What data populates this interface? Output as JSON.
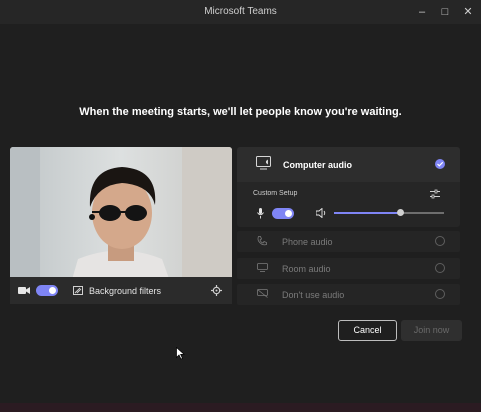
{
  "window": {
    "title": "Microsoft Teams",
    "controls": [
      "–",
      "□",
      "✕"
    ]
  },
  "headline": "When the meeting starts, we'll let people know you're waiting.",
  "video": {
    "camera_on": true,
    "background_filters_label": "Background filters"
  },
  "audio": {
    "selected": "Computer audio",
    "computer_audio_label": "Computer audio",
    "custom_setup_label": "Custom Setup",
    "mic_on": true,
    "volume_fraction": 0.6,
    "options": [
      {
        "label": "Phone audio",
        "icon": "phone-icon"
      },
      {
        "label": "Room audio",
        "icon": "room-icon"
      },
      {
        "label": "Don't use audio",
        "icon": "no-audio-icon"
      }
    ]
  },
  "buttons": {
    "cancel_label": "Cancel",
    "join_label": "Join now"
  },
  "colors": {
    "accent": "#7f85f5",
    "background": "#1f1f1f"
  }
}
